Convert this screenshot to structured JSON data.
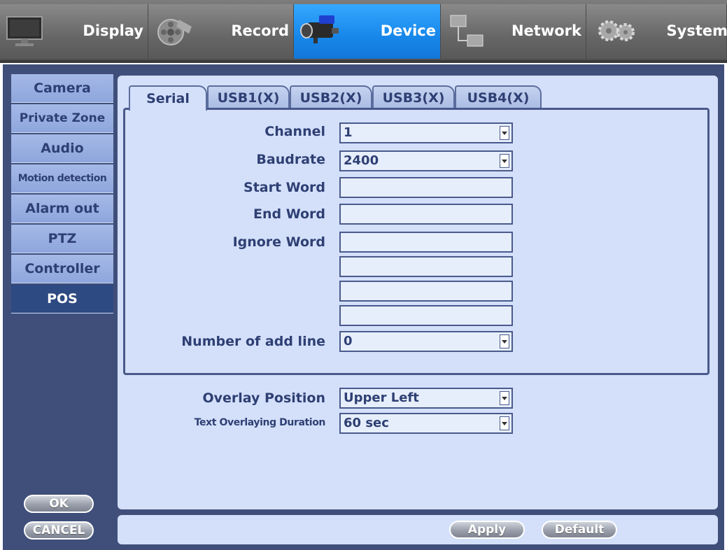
{
  "menu": {
    "display": "Display",
    "record": "Record",
    "device": "Device",
    "network": "Network",
    "system": "System"
  },
  "sidebar": {
    "items": [
      {
        "label": "Camera"
      },
      {
        "label": "Private Zone"
      },
      {
        "label": "Audio"
      },
      {
        "label": "Motion detection"
      },
      {
        "label": "Alarm out"
      },
      {
        "label": "PTZ"
      },
      {
        "label": "Controller"
      },
      {
        "label": "POS"
      }
    ],
    "ok": "OK",
    "cancel": "CANCEL"
  },
  "tabs": [
    "Serial",
    "USB1(X)",
    "USB2(X)",
    "USB3(X)",
    "USB4(X)"
  ],
  "form": {
    "channel_label": "Channel",
    "channel_value": "1",
    "baudrate_label": "Baudrate",
    "baudrate_value": "2400",
    "start_word_label": "Start Word",
    "start_word_value": "",
    "end_word_label": "End Word",
    "end_word_value": "",
    "ignore_word_label": "Ignore Word",
    "ignore_word_values": [
      "",
      "",
      "",
      ""
    ],
    "add_line_label": "Number of add line",
    "add_line_value": "0",
    "overlay_position_label": "Overlay Position",
    "overlay_position_value": "Upper Left",
    "overlay_duration_label": "Text Overlaying Duration",
    "overlay_duration_value": "60 sec"
  },
  "buttons": {
    "apply": "Apply",
    "default": "Default"
  },
  "colors": {
    "active_menu": "#1787ea",
    "panel": "#d4e0fa",
    "frame": "#3f4f7a",
    "label_text": "#2e3f73"
  }
}
